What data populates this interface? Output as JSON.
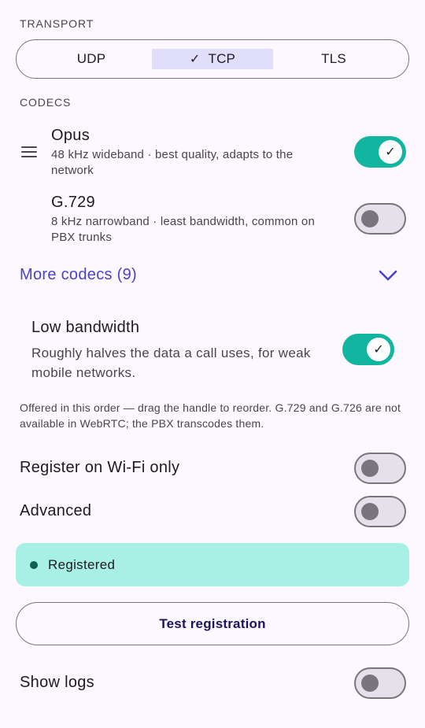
{
  "transport": {
    "label": "TRANSPORT",
    "options": [
      "UDP",
      "TCP",
      "TLS"
    ],
    "selected": "TCP",
    "check_glyph": "✓"
  },
  "codecs": {
    "label": "CODECS",
    "items": [
      {
        "name": "Opus",
        "description": "48 kHz wideband · best quality, adapts to the network",
        "enabled": true
      },
      {
        "name": "G.729",
        "description": "8 kHz narrowband · least bandwidth, common on PBX trunks",
        "enabled": false
      }
    ],
    "more_label": "More codecs (9)"
  },
  "low_bandwidth": {
    "title": "Low bandwidth",
    "description": "Roughly halves the data a call uses, for weak mobile networks.",
    "enabled": true
  },
  "note": "Offered in this order — drag the handle to reorder. G.729 and G.726 are not available in WebRTC; the PBX transcodes them.",
  "settings": {
    "wifi_only": {
      "label": "Register on Wi-Fi only",
      "enabled": false
    },
    "advanced": {
      "label": "Advanced",
      "enabled": false
    },
    "show_logs": {
      "label": "Show logs",
      "enabled": false
    }
  },
  "status": {
    "text": "Registered",
    "color": "#A8F0E6"
  },
  "test_button": {
    "label": "Test registration"
  },
  "colors": {
    "accent": "#12B5A0",
    "link": "#4A43C8",
    "selected_segment": "#E1DEFB"
  }
}
